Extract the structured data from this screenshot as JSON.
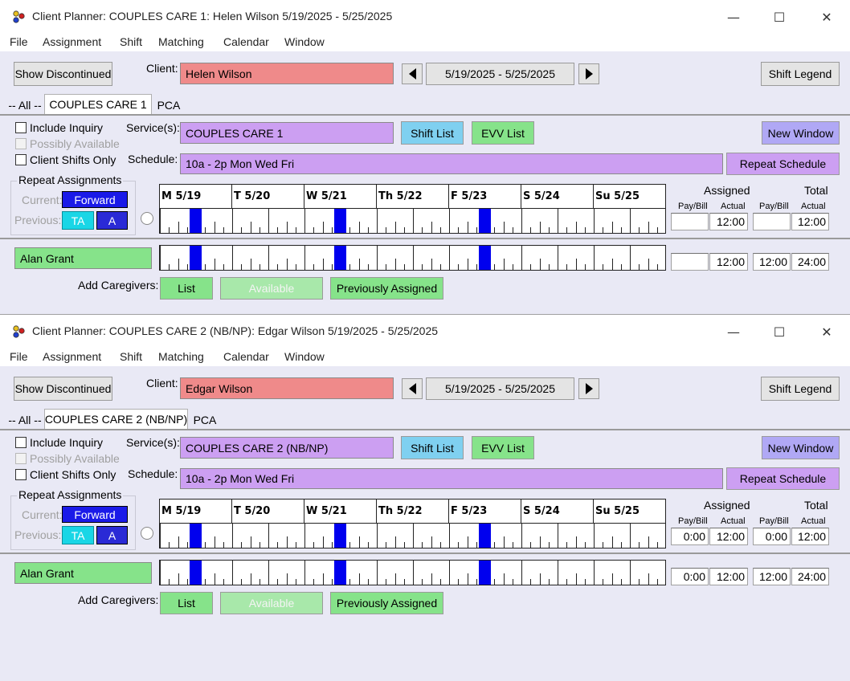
{
  "colors": {
    "client": "#ef8a8a",
    "service": "#cc9ff2",
    "green": "#86e38a",
    "blue_block": "#0000ee",
    "light_blue_button": "#7fd0f0",
    "new_window_button": "#b0a8f5",
    "forward_button": "#1a1ae8",
    "ta_button": "#19d6e6",
    "a_button": "#2a2ad6"
  },
  "menu": [
    "File",
    "Assignment",
    "Shift",
    "Matching",
    "Calendar",
    "Window"
  ],
  "window_controls": {
    "minimize": "—",
    "maximize": "☐",
    "close": "✕"
  },
  "windows": [
    {
      "title": "Client Planner: COUPLES CARE 1: Helen Wilson  5/19/2025 - 5/25/2025",
      "show_discontinued": "Show Discontinued",
      "client_label": "Client:",
      "client_name": "Helen Wilson",
      "date_range": "5/19/2025 - 5/25/2025",
      "shift_legend": "Shift Legend",
      "tabs": [
        "-- All --",
        "COUPLES CARE 1",
        "PCA"
      ],
      "include_inquiry": "Include Inquiry",
      "possibly_available": "Possibly Available",
      "client_shifts_only": "Client Shifts Only",
      "services_label": "Service(s):",
      "service_name": "COUPLES CARE 1",
      "shift_list": "Shift List",
      "evv_list": "EVV List",
      "new_window": "New Window",
      "schedule_label": "Schedule:",
      "schedule_text": "10a - 2p Mon Wed Fri",
      "repeat_schedule": "Repeat Schedule",
      "repeat_assignments": "Repeat Assignments",
      "current_label": "Current:",
      "forward": "Forward",
      "previous_label": "Previous:",
      "ta": "TA",
      "a": "A",
      "days": [
        "M 5/19",
        "T 5/20",
        "W 5/21",
        "Th 5/22",
        "F 5/23",
        "S 5/24",
        "Su 5/25"
      ],
      "assigned_label": "Assigned",
      "total_label": "Total",
      "pay_bill": "Pay/Bill",
      "actual": "Actual",
      "client_row": {
        "assigned_pay": "",
        "assigned_actual": "12:00",
        "total_pay": "",
        "total_actual": "12:00"
      },
      "caregiver": {
        "name": "Alan Grant",
        "assigned_pay": "",
        "assigned_actual": "12:00",
        "total_pay": "12:00",
        "total_actual": "24:00"
      },
      "add_caregivers": "Add Caregivers:",
      "list_btn": "List",
      "available_btn": "Available",
      "previously_assigned_btn": "Previously Assigned"
    },
    {
      "title": "Client Planner: COUPLES CARE 2 (NB/NP): Edgar Wilson  5/19/2025 - 5/25/2025",
      "show_discontinued": "Show Discontinued",
      "client_label": "Client:",
      "client_name": "Edgar Wilson",
      "date_range": "5/19/2025 - 5/25/2025",
      "shift_legend": "Shift Legend",
      "tabs": [
        "-- All --",
        "COUPLES CARE 2 (NB/NP)",
        "PCA"
      ],
      "include_inquiry": "Include Inquiry",
      "possibly_available": "Possibly Available",
      "client_shifts_only": "Client Shifts Only",
      "services_label": "Service(s):",
      "service_name": "COUPLES CARE 2 (NB/NP)",
      "shift_list": "Shift List",
      "evv_list": "EVV List",
      "new_window": "New Window",
      "schedule_label": "Schedule:",
      "schedule_text": "10a - 2p Mon Wed Fri",
      "repeat_schedule": "Repeat Schedule",
      "repeat_assignments": "Repeat Assignments",
      "current_label": "Current:",
      "forward": "Forward",
      "previous_label": "Previous:",
      "ta": "TA",
      "a": "A",
      "days": [
        "M 5/19",
        "T 5/20",
        "W 5/21",
        "Th 5/22",
        "F 5/23",
        "S 5/24",
        "Su 5/25"
      ],
      "assigned_label": "Assigned",
      "total_label": "Total",
      "pay_bill": "Pay/Bill",
      "actual": "Actual",
      "client_row": {
        "assigned_pay": "0:00",
        "assigned_actual": "12:00",
        "total_pay": "0:00",
        "total_actual": "12:00"
      },
      "caregiver": {
        "name": "Alan Grant",
        "assigned_pay": "0:00",
        "assigned_actual": "12:00",
        "total_pay": "12:00",
        "total_actual": "24:00"
      },
      "add_caregivers": "Add Caregivers:",
      "list_btn": "List",
      "available_btn": "Available",
      "previously_assigned_btn": "Previously Assigned"
    }
  ]
}
